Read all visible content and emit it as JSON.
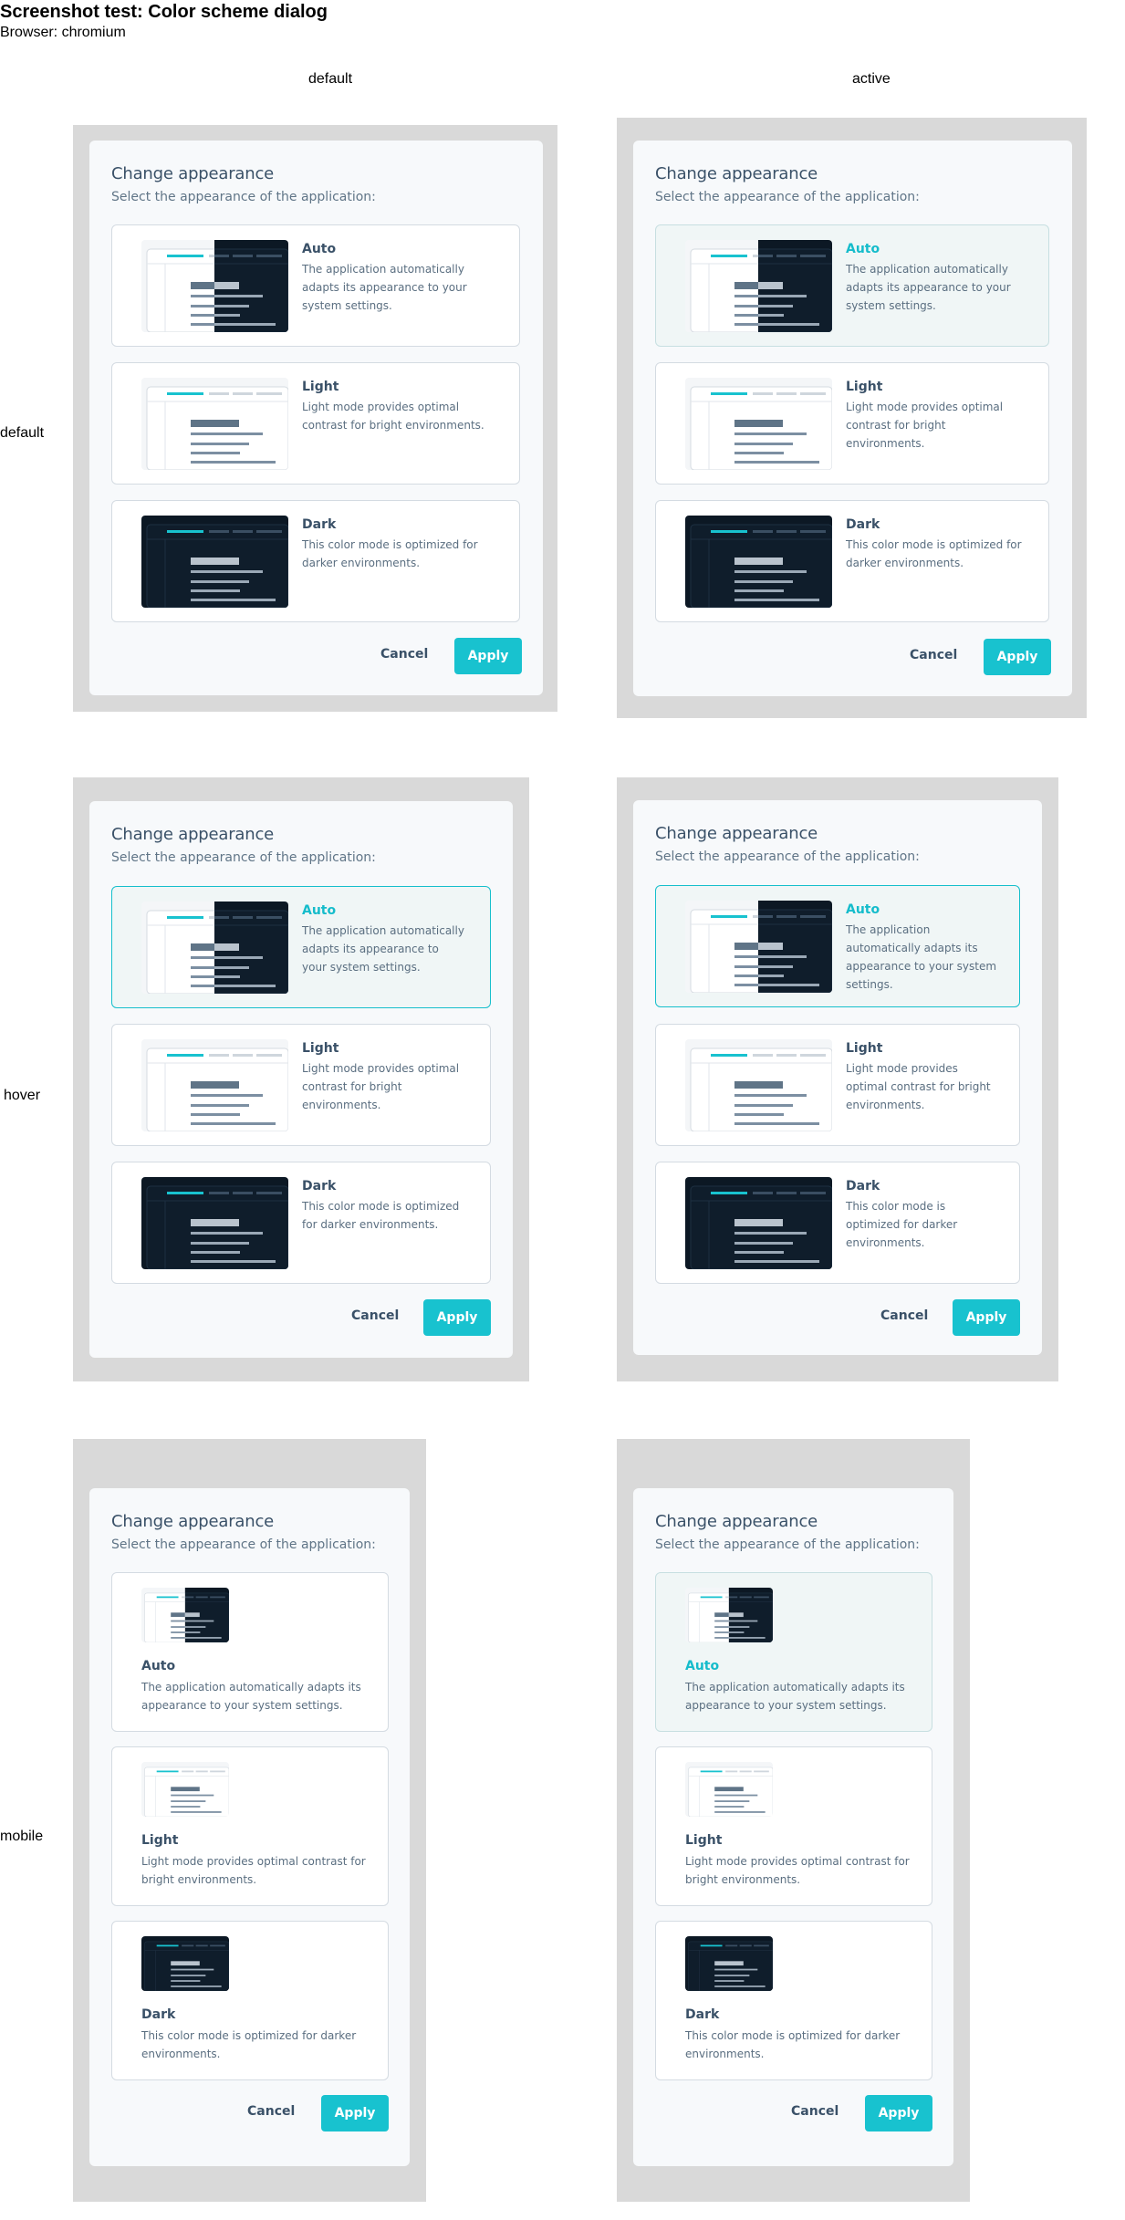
{
  "page": {
    "title": "Screenshot test: Color scheme dialog",
    "subtitle": "Browser: chromium",
    "columns": [
      "default",
      "active"
    ],
    "rows": [
      "default",
      "hover",
      "mobile"
    ]
  },
  "dialog": {
    "title": "Change appearance",
    "subtitle": "Select the appearance of the application:",
    "options": [
      {
        "name": "Auto",
        "description": "The application automatically adapts its appearance to your system settings.",
        "preview": "auto-preview-icon"
      },
      {
        "name": "Light",
        "description": "Light mode provides optimal contrast for bright environments.",
        "preview": "light-preview-icon"
      },
      {
        "name": "Dark",
        "description": "This color mode is optimized for darker environments.",
        "preview": "dark-preview-icon"
      }
    ],
    "cancel_label": "Cancel",
    "apply_label": "Apply"
  },
  "states": [
    {
      "row": "default",
      "column": "default",
      "selected_option": "",
      "hovered_option": ""
    },
    {
      "row": "default",
      "column": "active",
      "selected_option": "Auto",
      "hovered_option": ""
    },
    {
      "row": "hover",
      "column": "default",
      "selected_option": "Auto",
      "hovered_option": "Auto"
    },
    {
      "row": "hover",
      "column": "active",
      "selected_option": "Auto",
      "hovered_option": "Auto"
    },
    {
      "row": "mobile",
      "column": "default",
      "selected_option": "",
      "hovered_option": ""
    },
    {
      "row": "mobile",
      "column": "active",
      "selected_option": "Auto",
      "hovered_option": ""
    }
  ],
  "colors": {
    "accent": "#18c2cf",
    "frame_background": "#d9d9d9",
    "dialog_background": "#f7f9fb",
    "option_selected_background": "#f0f6f6",
    "dark_preview": "#0c1824",
    "text_primary": "#3a5168"
  }
}
